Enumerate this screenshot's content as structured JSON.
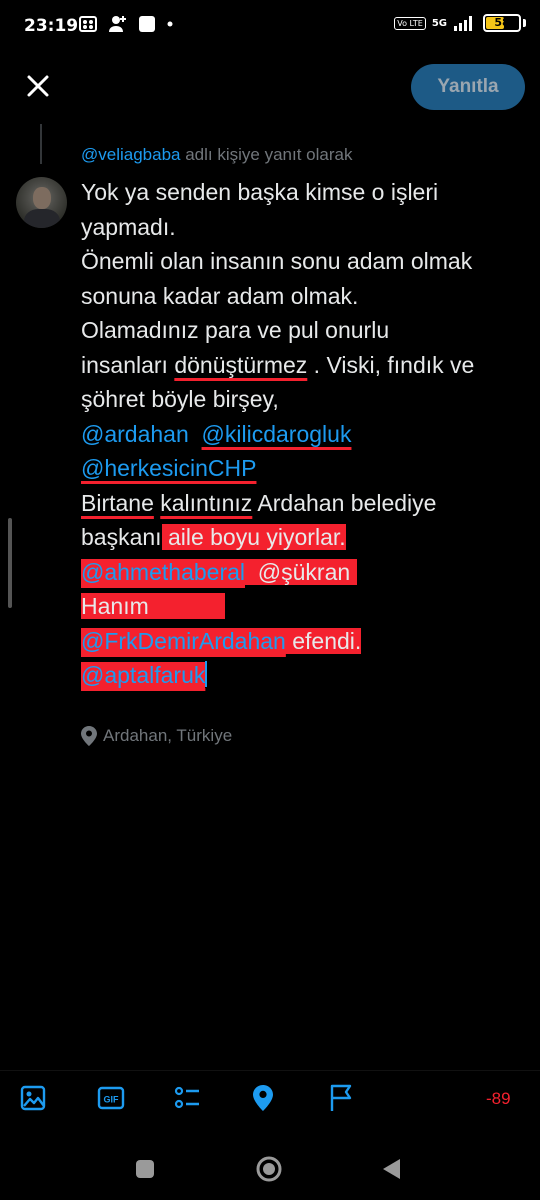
{
  "status_bar": {
    "time": "23:19",
    "network": "5G",
    "volte": "Vo LTE",
    "battery_percent": "58",
    "battery_level": 0.58,
    "left_icons": [
      "film-icon",
      "person-add-icon",
      "app-square-icon",
      "dot-icon"
    ]
  },
  "header": {
    "reply_button_label": "Yanıtla",
    "close_icon": "close-icon"
  },
  "reply_context": {
    "handle": "@veliagbaba",
    "suffix": " adlı kişiye yanıt olarak"
  },
  "tweet": {
    "lines": {
      "l1": "Yok ya senden başka kimse o işleri",
      "l2": "yapmadı.",
      "l3": "Önemli olan insanın sonu adam olmak",
      "l4": "sonuna kadar adam olmak.",
      "l5": "Olamadınız para ve pul onurlu",
      "l6a": "insanları ",
      "l6b": "dönüştürmez",
      "l6c": " . Viski, fındık ve",
      "l7": "şöhret böyle birşey,",
      "l8a": "@ardahan",
      "l8b": "@kilicdarogluk",
      "l9": "@herkesicinCHP",
      "l10a": "Birtane",
      "l10b": "kalıntınız",
      "l10c": " Ardahan belediye",
      "l11a": "başkanı",
      "l11b": " aile boyu yiyorlar.",
      "l12a": "@ahmethaberal",
      "l12b": "  @şükran",
      "l13": "Hanım",
      "l14a": "@FrkDemirArdahan",
      "l14b": " efendi.",
      "l15": "@aptalfaruk"
    },
    "location": "Ardahan, Türkiye"
  },
  "toolbar": {
    "icons": [
      "image-icon",
      "gif-icon",
      "poll-icon",
      "location-icon",
      "schedule-flag-icon"
    ],
    "char_counter": "-89"
  },
  "colors": {
    "accent": "#1d9bf0",
    "highlight": "#f4212e",
    "reply_button": "#1d5a86",
    "muted": "#71767b"
  }
}
